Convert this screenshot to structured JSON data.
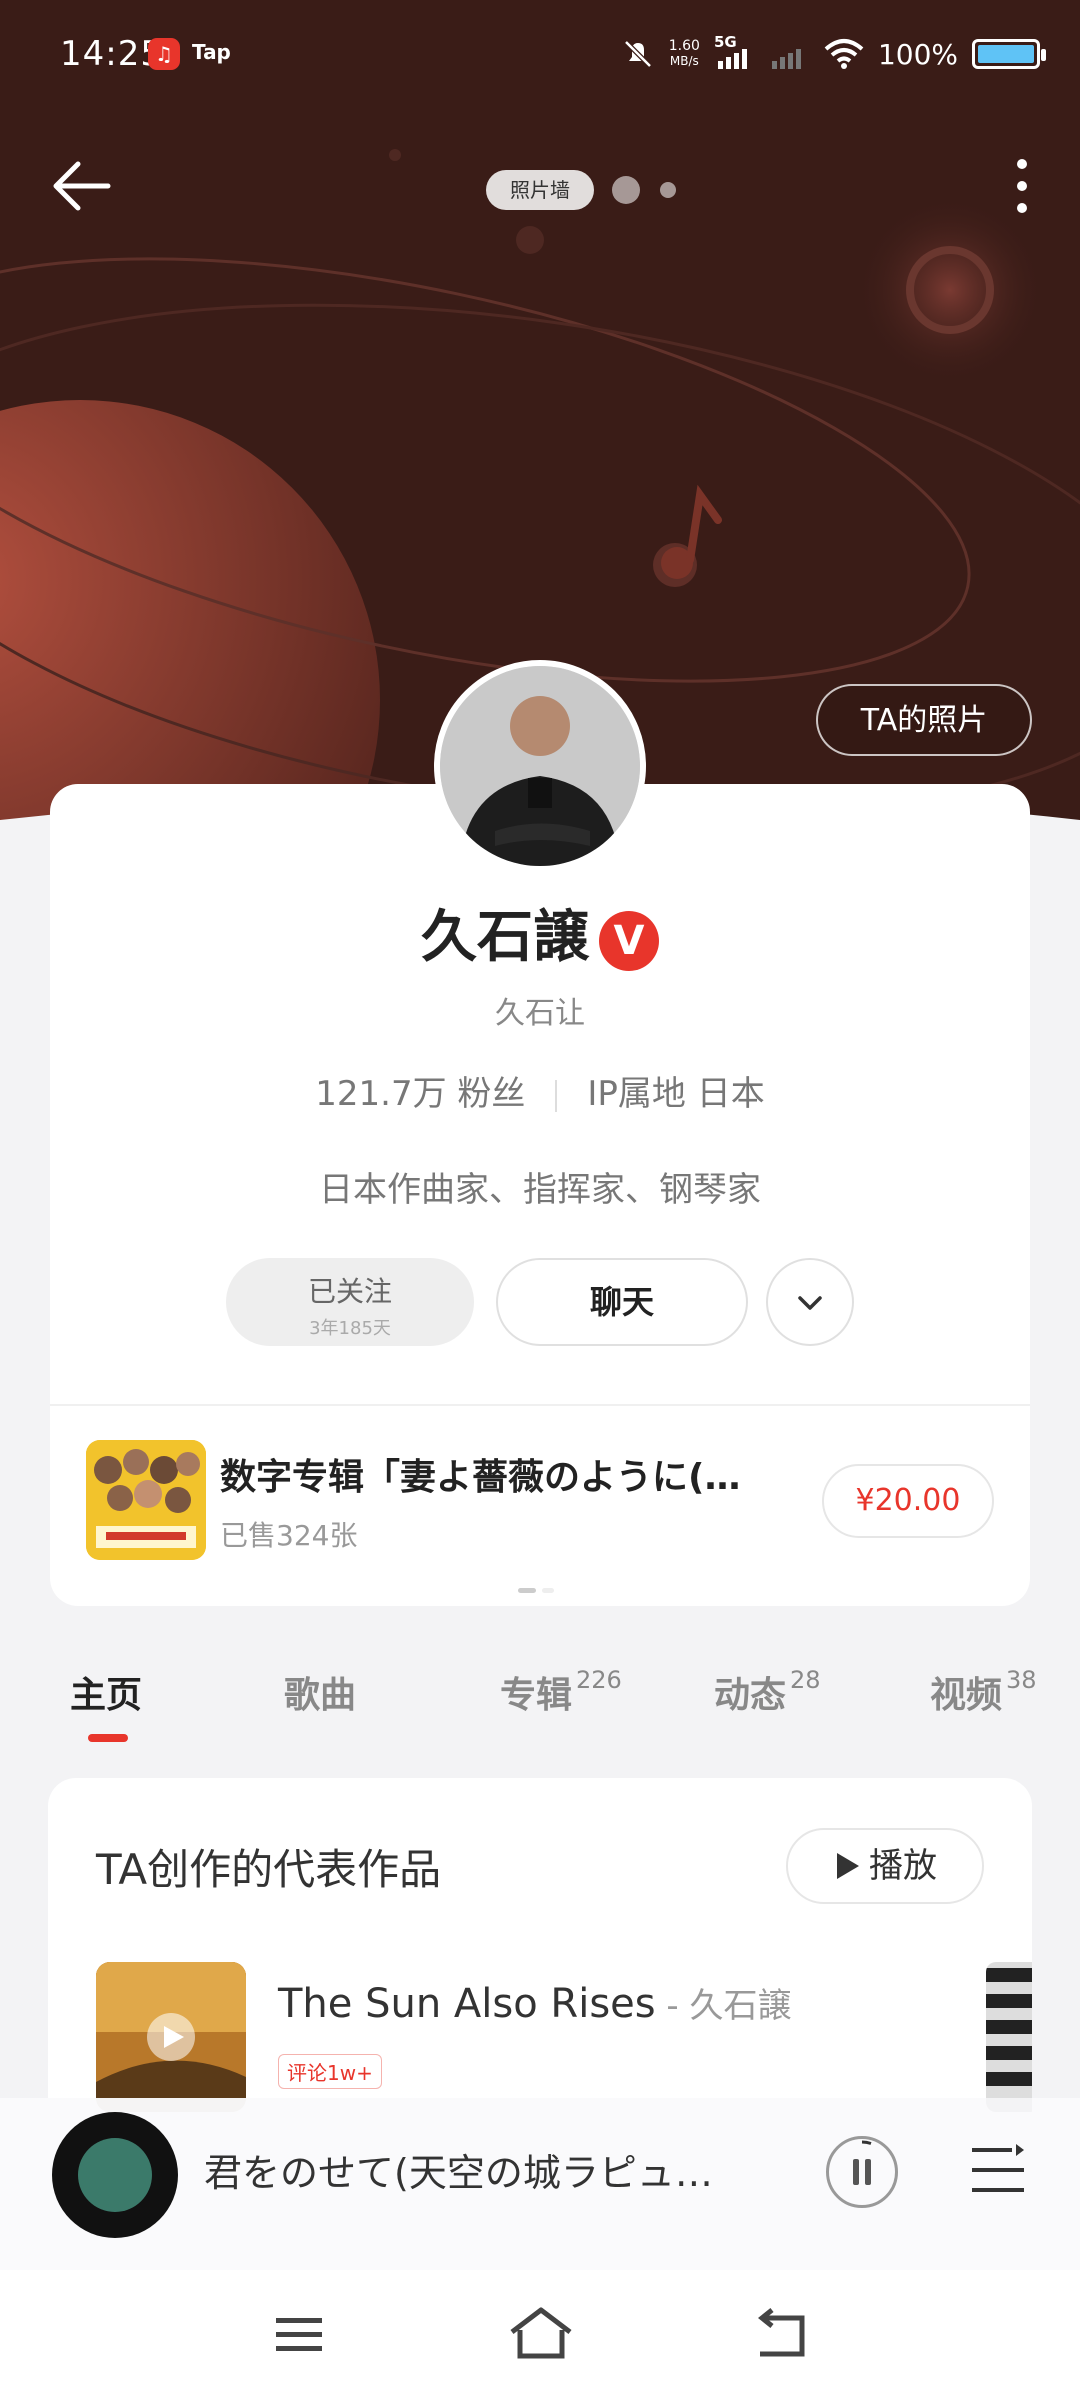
{
  "status_bar": {
    "time": "14:25",
    "app_badge_icon": "netease-music-icon",
    "tap_label": "Tap",
    "speed_value": "1.60",
    "speed_unit": "MB/s",
    "network": "5G",
    "battery": "100%"
  },
  "header": {
    "photo_wall_label": "照片墙",
    "ta_photos_label": "TA的照片"
  },
  "profile": {
    "name": "久石譲",
    "verified_badge": "V",
    "alias": "久石让",
    "fans": "121.7万 粉丝",
    "ip_location": "IP属地 日本",
    "bio": "日本作曲家、指挥家、钢琴家",
    "follow_label": "已关注",
    "follow_duration": "3年185天",
    "chat_label": "聊天"
  },
  "promo": {
    "title": "数字专辑「妻よ薔薇のように(…",
    "sold": "已售324张",
    "price": "¥20.00"
  },
  "tabs": [
    {
      "label": "主页",
      "count": ""
    },
    {
      "label": "歌曲",
      "count": ""
    },
    {
      "label": "专辑",
      "count": "226"
    },
    {
      "label": "动态",
      "count": "28"
    },
    {
      "label": "视频",
      "count": "38"
    }
  ],
  "works": {
    "title": "TA创作的代表作品",
    "play_label": "播放",
    "song_title": "The Sun Also Rises",
    "song_artist": " - 久石譲",
    "song_tag": "评论1w+"
  },
  "player": {
    "now_playing": "君をのせて(天空の城ラピュ…"
  },
  "colors": {
    "accent": "#e8352b",
    "header_bg": "#3a1c17"
  }
}
